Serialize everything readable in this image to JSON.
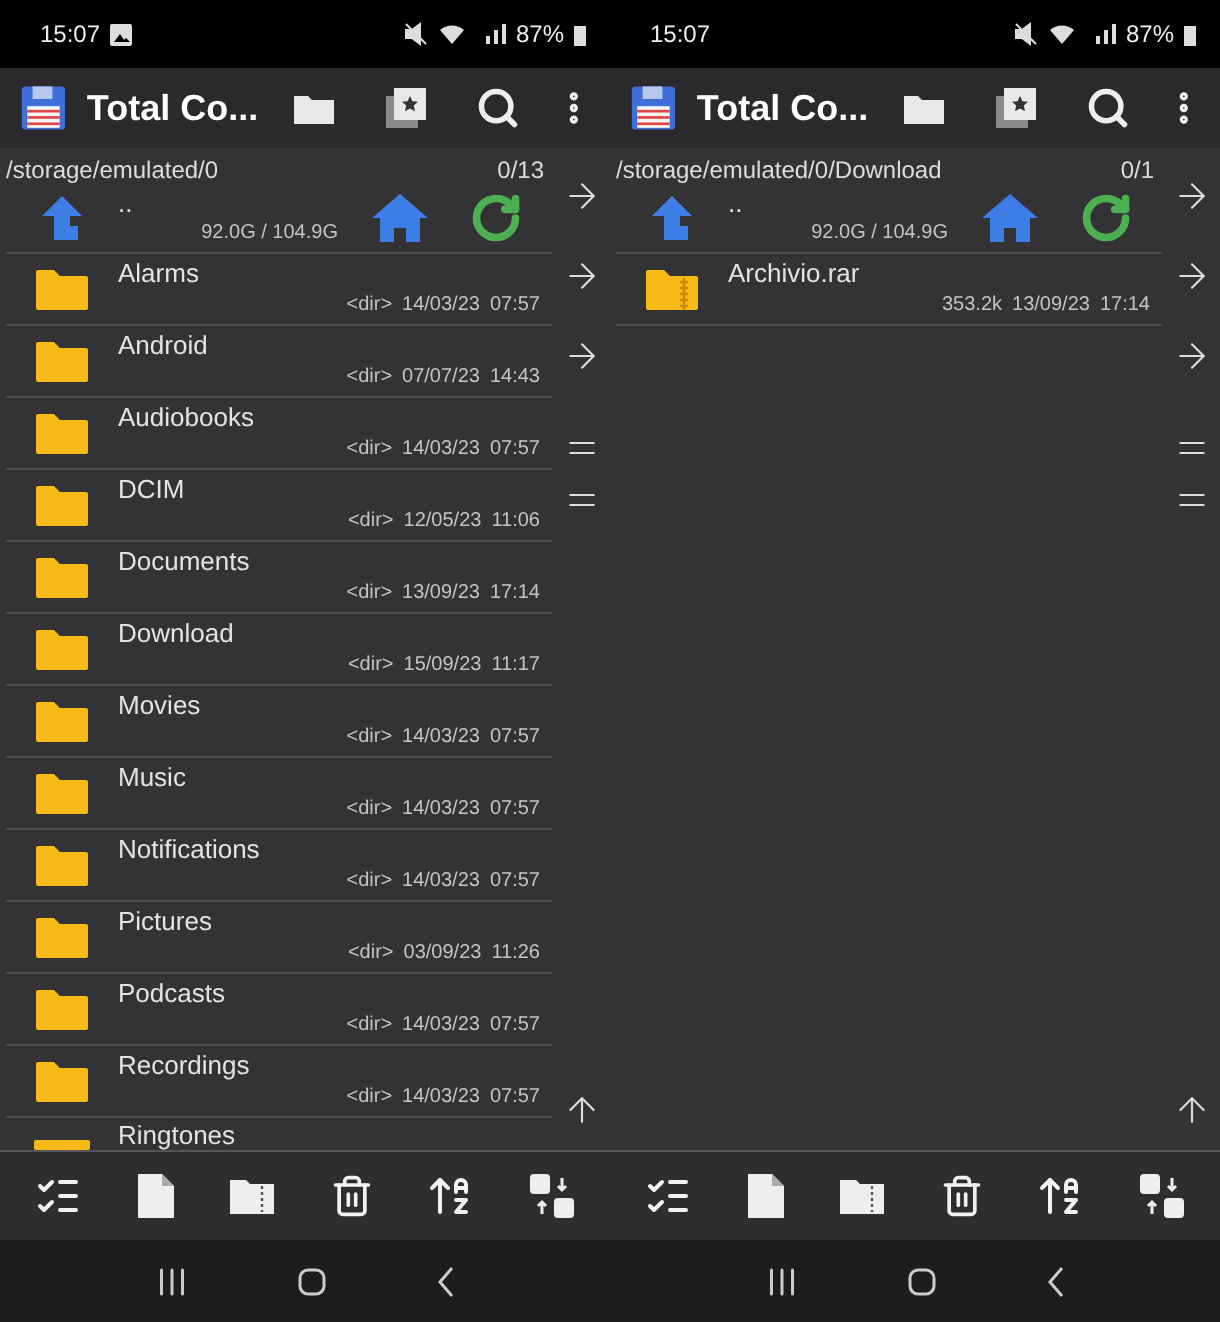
{
  "panels": [
    {
      "status_bar": {
        "time": "15:07",
        "battery": "87%",
        "image_notification": true
      },
      "app_bar": {
        "title": "Total Co..."
      },
      "path": "/storage/emulated/0",
      "count": "0/13",
      "parent": {
        "name": "..",
        "disk": "92.0G / 104.9G"
      },
      "files": [
        {
          "kind": "folder",
          "name": "Alarms",
          "size": "<dir>",
          "date": "14/03/23",
          "time": "07:57"
        },
        {
          "kind": "folder",
          "name": "Android",
          "size": "<dir>",
          "date": "07/07/23",
          "time": "14:43"
        },
        {
          "kind": "folder",
          "name": "Audiobooks",
          "size": "<dir>",
          "date": "14/03/23",
          "time": "07:57"
        },
        {
          "kind": "folder",
          "name": "DCIM",
          "size": "<dir>",
          "date": "12/05/23",
          "time": "11:06"
        },
        {
          "kind": "folder",
          "name": "Documents",
          "size": "<dir>",
          "date": "13/09/23",
          "time": "17:14"
        },
        {
          "kind": "folder",
          "name": "Download",
          "size": "<dir>",
          "date": "15/09/23",
          "time": "11:17"
        },
        {
          "kind": "folder",
          "name": "Movies",
          "size": "<dir>",
          "date": "14/03/23",
          "time": "07:57"
        },
        {
          "kind": "folder",
          "name": "Music",
          "size": "<dir>",
          "date": "14/03/23",
          "time": "07:57"
        },
        {
          "kind": "folder",
          "name": "Notifications",
          "size": "<dir>",
          "date": "14/03/23",
          "time": "07:57"
        },
        {
          "kind": "folder",
          "name": "Pictures",
          "size": "<dir>",
          "date": "03/09/23",
          "time": "11:26"
        },
        {
          "kind": "folder",
          "name": "Podcasts",
          "size": "<dir>",
          "date": "14/03/23",
          "time": "07:57"
        },
        {
          "kind": "folder",
          "name": "Recordings",
          "size": "<dir>",
          "date": "14/03/23",
          "time": "07:57"
        }
      ],
      "partial_file": {
        "kind": "folder",
        "name": "Ringtones"
      }
    },
    {
      "status_bar": {
        "time": "15:07",
        "battery": "87%",
        "image_notification": false
      },
      "app_bar": {
        "title": "Total Co..."
      },
      "path": "/storage/emulated/0/Download",
      "count": "0/1",
      "parent": {
        "name": "..",
        "disk": "92.0G / 104.9G"
      },
      "files": [
        {
          "kind": "archive",
          "name": "Archivio.rar",
          "size": "353.2k",
          "date": "13/09/23",
          "time": "17:14"
        }
      ]
    }
  ]
}
